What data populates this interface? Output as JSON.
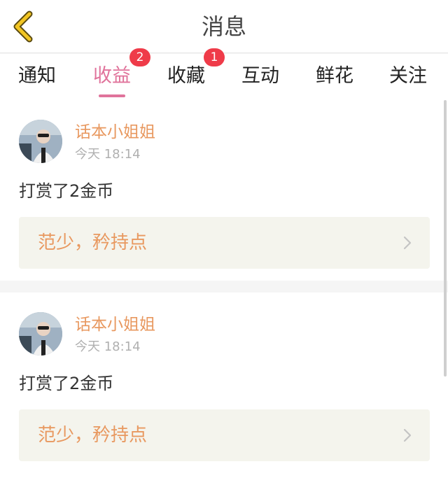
{
  "header": {
    "title": "消息",
    "back_icon": "chevron-left-icon",
    "accent_color": "#f2c523"
  },
  "tabs": [
    {
      "label": "通知",
      "badge": null,
      "active": false
    },
    {
      "label": "收益",
      "badge": "2",
      "active": true
    },
    {
      "label": "收藏",
      "badge": "1",
      "active": false
    },
    {
      "label": "互动",
      "badge": null,
      "active": false
    },
    {
      "label": "鲜花",
      "badge": null,
      "active": false
    },
    {
      "label": "关注",
      "badge": null,
      "active": false
    }
  ],
  "active_color": "#e0739b",
  "notifications": [
    {
      "username": "话本小姐姐",
      "time": "今天 18:14",
      "action": "打赏了2金币",
      "message": "范少，矜持点"
    },
    {
      "username": "话本小姐姐",
      "time": "今天 18:14",
      "action": "打赏了2金币",
      "message": "范少，矜持点"
    }
  ]
}
